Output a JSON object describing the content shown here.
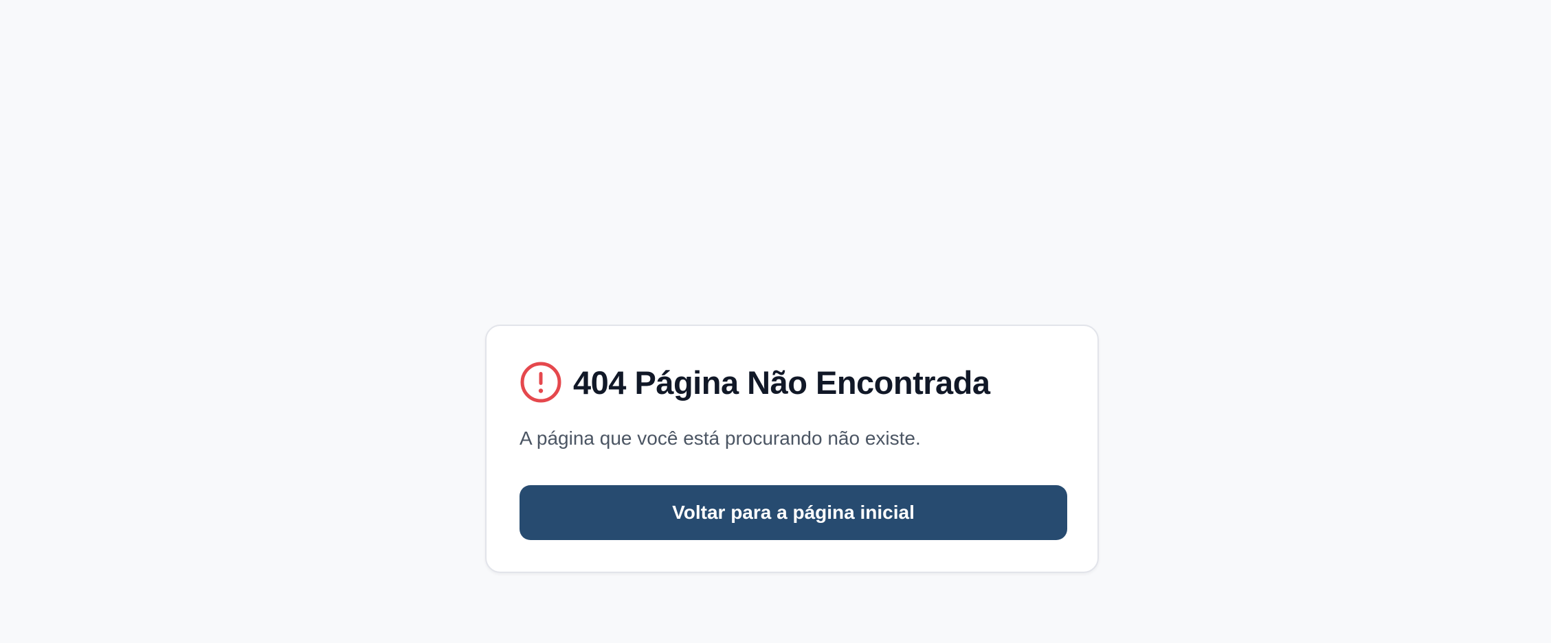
{
  "error_card": {
    "title": "404 Página Não Encontrada",
    "message": "A página que você está procurando não existe.",
    "home_button_label": "Voltar para a página inicial",
    "icon": "alert-circle-icon"
  },
  "colors": {
    "page_background": "#f8f9fb",
    "card_background": "#ffffff",
    "icon": "#e5484d",
    "title": "#111827",
    "message": "#4b5563",
    "button_background": "#274b70",
    "button_text": "#ffffff"
  }
}
